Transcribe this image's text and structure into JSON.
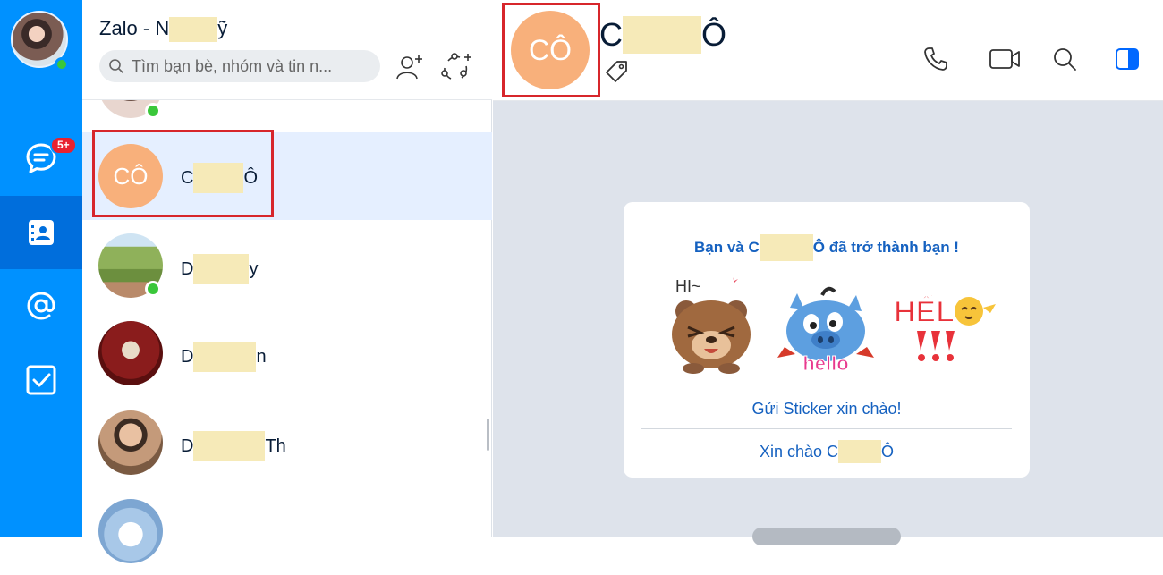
{
  "rail": {
    "chat_badge": "5+",
    "colors": {
      "rail": "#0091ff",
      "active": "#006edc",
      "badge": "#e8212f"
    }
  },
  "header": {
    "app_title_prefix": "Zalo - N",
    "app_title_suffix": "ỹ",
    "search_placeholder": "Tìm bạn bè, nhóm và tin n..."
  },
  "contacts": [
    {
      "initials": "CÔ",
      "name_start": "C",
      "name_end": "Ô",
      "selected": true
    },
    {
      "name_start": "D",
      "name_end": "y",
      "online": true
    },
    {
      "name_start": "D",
      "name_end": "n"
    },
    {
      "name_start": "D",
      "name_end": "Th"
    }
  ],
  "chat": {
    "avatar_initials": "CÔ",
    "name_start": "C",
    "name_end": "Ô",
    "welcome": {
      "title_start": "Bạn và C",
      "title_end": "Ô đã trở thành bạn !",
      "stickers": [
        {
          "icon": "bear-sticker",
          "caption": "HI~"
        },
        {
          "icon": "blue-monster-sticker",
          "caption": "hello"
        },
        {
          "icon": "chick-sticker",
          "caption": "HẾL"
        }
      ],
      "send_sticker": "Gửi Sticker xin chào!",
      "greet_start": "Xin chào C",
      "greet_end": "Ô"
    }
  },
  "accent_colors": {
    "link": "#1561c0",
    "avatar_orange": "#f8b07b",
    "highlight": "#d7262b",
    "online": "#3ac73a"
  }
}
